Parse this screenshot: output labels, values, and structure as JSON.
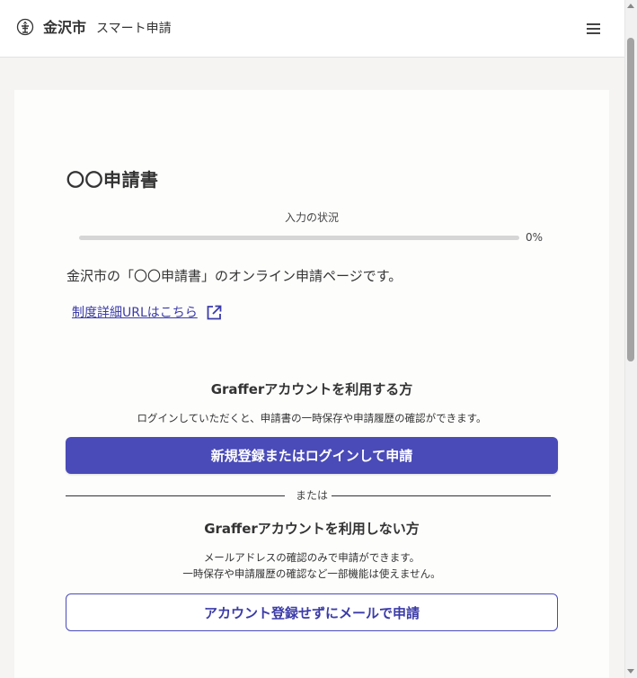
{
  "header": {
    "city_name": "金沢市",
    "service_name": "スマート申請",
    "logo_icon": "city-emblem-icon",
    "menu_icon": "hamburger-menu-icon"
  },
  "form": {
    "title": "〇〇申請書",
    "progress_label": "入力の状況",
    "progress_value": 0,
    "progress_text": "0%",
    "intro": "金沢市の「〇〇申請書」のオンライン申請ページです。",
    "detail_link": "制度詳細URLはこちら",
    "detail_link_icon": "external-link-icon"
  },
  "with_account": {
    "heading": "Grafferアカウントを利用する方",
    "description": "ログインしていただくと、申請書の一時保存や申請履歴の確認ができます。",
    "button_label": "新規登録またはログインして申請"
  },
  "divider": {
    "label": "または"
  },
  "without_account": {
    "heading": "Grafferアカウントを利用しない方",
    "description_line1": "メールアドレスの確認のみで申請ができます。",
    "description_line2": "一時保存や申請履歴の確認など一部機能は使えません。",
    "button_label": "アカウント登録せずにメールで申請"
  },
  "colors": {
    "accent": "#4a4bb8",
    "link": "#3b3ba8",
    "background": "#f5f4f2",
    "card": "#fdfdfc"
  }
}
